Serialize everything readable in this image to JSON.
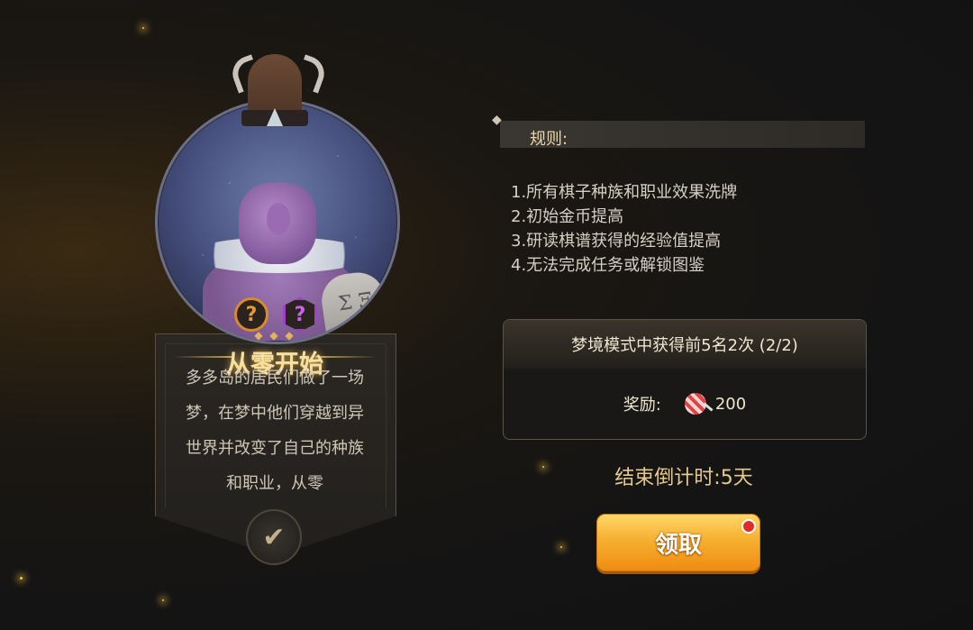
{
  "card": {
    "title": "从零开始",
    "badge_1": "?",
    "badge_2": "?",
    "tablet_text": "Σ Ξ",
    "description": "多多岛的居民们做了一场梦，在梦中他们穿越到异世界并改变了自己的种族和职业，从零",
    "confirm_icon": "check-icon"
  },
  "rules": {
    "label": "规则:",
    "items": [
      "1.所有棋子种族和职业效果洗牌",
      "2.初始金币提高",
      "3.研读棋谱获得的经验值提高",
      "4.无法完成任务或解锁图鉴"
    ]
  },
  "task": {
    "title": "梦境模式中获得前5名2次 (2/2)",
    "reward_label": "奖励:",
    "reward_icon": "candy-icon",
    "reward_amount": "200"
  },
  "countdown": "结束倒计时:5天",
  "claim_button": "领取",
  "colors": {
    "accent": "#f6b030",
    "title_gold": "#f7e1a2",
    "notification": "#e12a2a"
  }
}
